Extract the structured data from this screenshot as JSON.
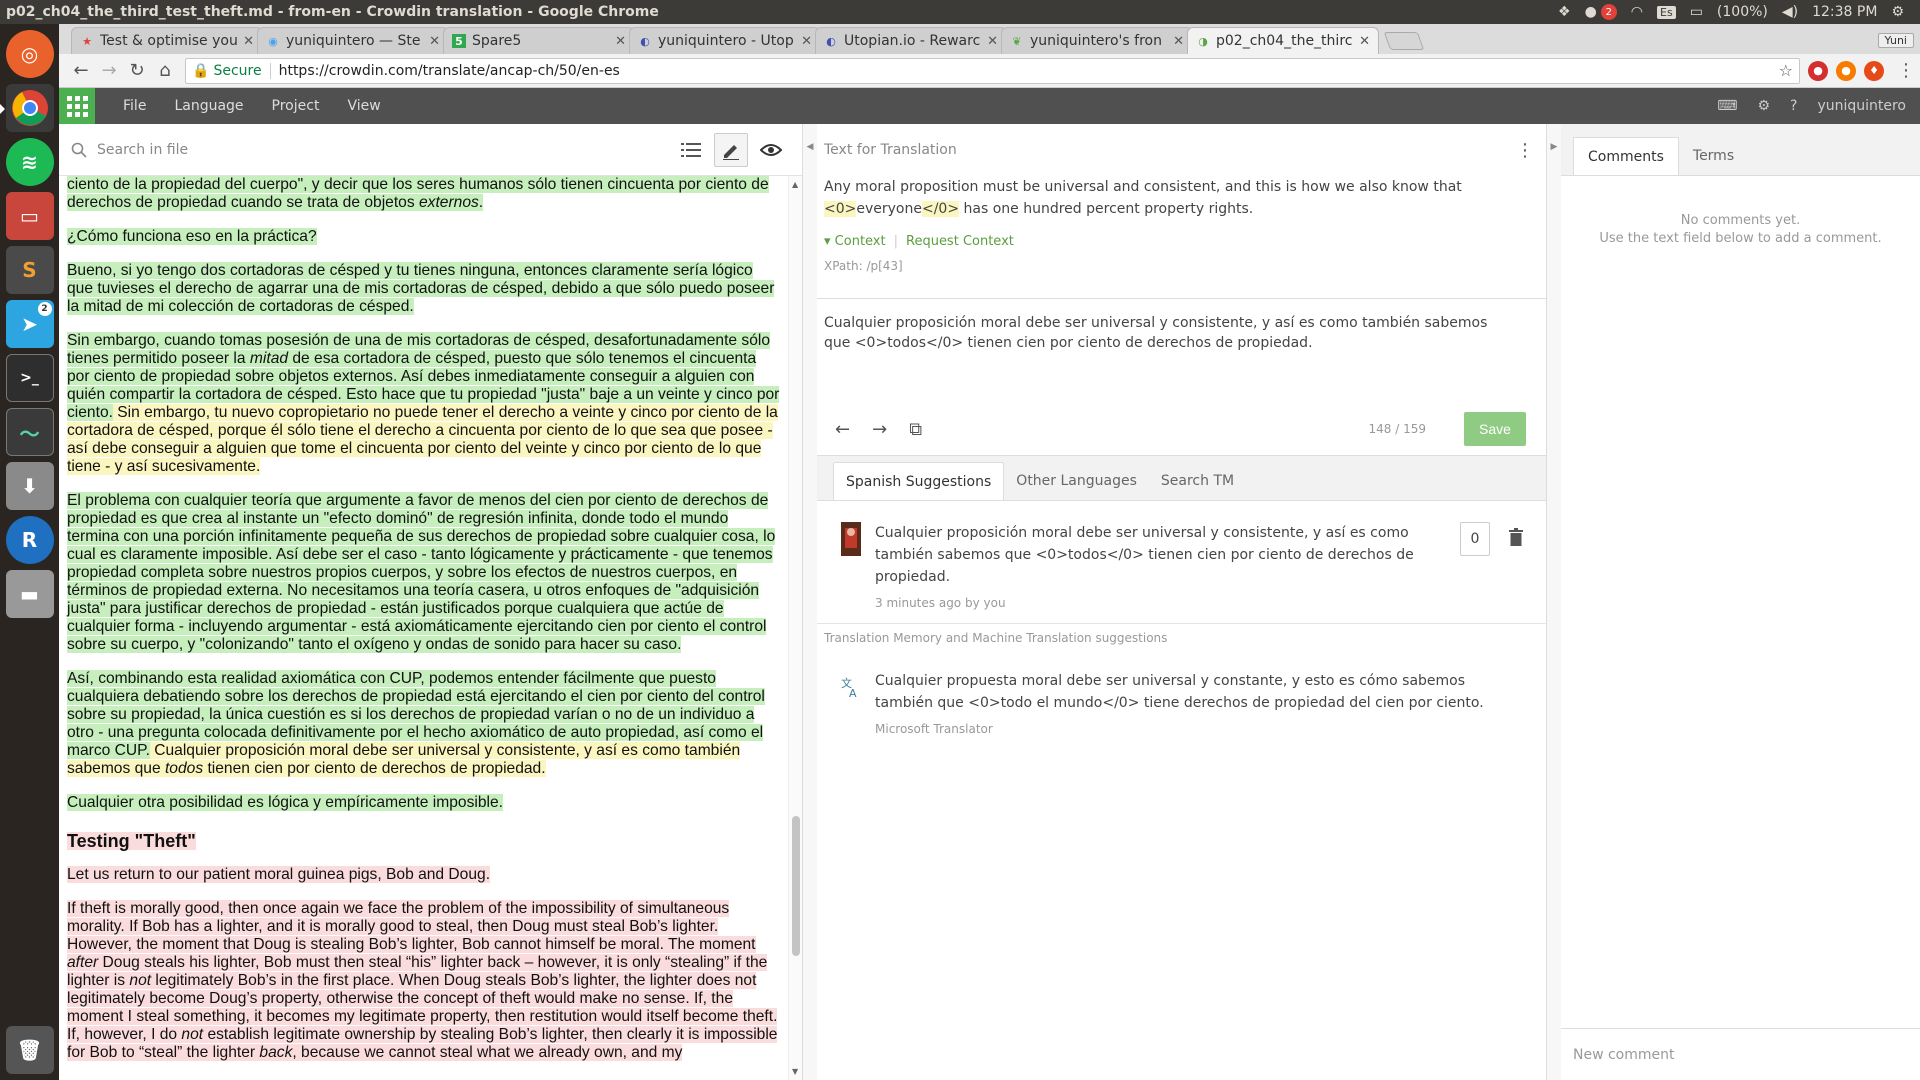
{
  "os": {
    "window_title": "p02_ch04_the_third_test_theft.md - from-en - Crowdin translation - Google Chrome",
    "tray": {
      "notification_count": "2",
      "keyboard": "Es",
      "battery": "(100%)",
      "time": "12:38 PM"
    },
    "launcher_badges": {
      "telegram": "2"
    }
  },
  "browser": {
    "tabs": [
      {
        "label": "Test & optimise you",
        "icon": "star-icon",
        "color": "#e0413b",
        "active": false
      },
      {
        "label": "yuniquintero — Ste",
        "icon": "steem-icon",
        "color": "#4ba2f2",
        "active": false
      },
      {
        "label": "Spare5",
        "icon": "spare5-icon",
        "color": "#2fa84f",
        "active": false
      },
      {
        "label": "yuniquintero - Utop",
        "icon": "utopian-icon",
        "color": "#3f51b5",
        "active": false
      },
      {
        "label": "Utopian.io - Rewarc",
        "icon": "utopian-icon",
        "color": "#3f51b5",
        "active": false
      },
      {
        "label": "yuniquintero's fron",
        "icon": "leaf-icon",
        "color": "#5aa845",
        "active": false
      },
      {
        "label": "p02_ch04_the_thirc",
        "icon": "crowdin-icon",
        "color": "#5aa845",
        "active": true
      }
    ],
    "profile": "Yuni",
    "secure_label": "Secure",
    "url": "https://crowdin.com/translate/ancap-ch/50/en-es"
  },
  "app": {
    "menu": [
      "File",
      "Language",
      "Project",
      "View"
    ],
    "user": "yuniquintero"
  },
  "left_panel": {
    "search_placeholder": "Search in file",
    "paragraphs": {
      "p1a": "ciento de la propiedad del cuerpo\", y decir que los seres humanos sólo tienen cincuenta por ciento de derechos de propiedad cuando se trata de objetos ",
      "p1b": "externos",
      "p1c": ".",
      "p2": "¿Cómo funciona eso en la práctica?",
      "p3": "Bueno, si yo tengo dos cortadoras de césped y tu tienes ninguna, entonces claramente sería lógico que tuvieses el derecho de agarrar una de mis cortadoras de césped, debido a que sólo puedo poseer la mitad de mi colección de cortadoras de césped.",
      "p4a": "Sin embargo, cuando tomas posesión de una de mis cortadoras de césped, desafortunadamente sólo tienes permitido poseer la ",
      "p4b": "mitad",
      "p4c": " de esa cortadora de césped, puesto que sólo tenemos el cincuenta por ciento de propiedad sobre objetos externos. Así debes inmediatamente conseguir a alguien con quién compartir la cortadora de césped. Esto hace que tu propiedad \"justa\" baje a un veinte y cinco por ciento.",
      "p4d": " Sin embargo, tu nuevo copropietario no puede tener el derecho a veinte y cinco por ciento de la cortadora de césped, porque él sólo tiene el derecho a cincuenta por ciento de lo que sea que posee - así debe conseguir a alguien que tome el cincuenta por ciento del veinte y cinco por ciento de lo que tiene - y así sucesivamente.",
      "p5": "El problema con cualquier teoría que argumente a favor de menos del cien por ciento de derechos de propiedad es que crea al instante un \"efecto dominó\" de regresión infinita, donde todo el mundo termina con una porción infinitamente pequeña de sus derechos de propiedad sobre cualquier cosa, lo cual es claramente imposible. Así debe ser el caso - tanto lógicamente y prácticamente - que tenemos propiedad completa sobre nuestros propios cuerpos, y sobre los efectos de nuestros cuerpos, en términos de propiedad externa. No necesitamos una teoría casera, u otros enfoques de \"adquisición justa\" para justificar derechos de propiedad - están justificados porque cualquiera que actúe de cualquier forma - incluyendo argumentar - está axiomáticamente ejercitando cien por ciento el control sobre su cuerpo, y \"colonizando\" tanto el oxígeno y ondas de sonido para hacer su caso.",
      "p6a": "Así, combinando esta realidad axiomática con CUP, podemos entender fácilmente que puesto cualquiera debatiendo sobre los derechos de propiedad está ejercitando el cien por ciento del control sobre su propiedad, la única cuestión es si los derechos de propiedad varían o no de un individuo a otro - una pregunta colocada definitivamente por el hecho axiomático de auto propiedad, así como el marco CUP.",
      "p6b": " Cualquier proposición moral debe ser universal y consistente, y así es como también sabemos que ",
      "p6c": "todos",
      "p6d": " tienen cien por ciento de derechos de propiedad.",
      "p7": "Cualquier otra posibilidad es lógica y empíricamente imposible.",
      "h_testing": "Testing \"Theft\"",
      "p8": "Let us return to our patient moral guinea pigs, Bob and Doug.",
      "p9a": "If theft is morally good, then once again we face the problem of the impossibility of simultaneous morality. If Bob has a lighter, and it is morally good to steal, then Doug must steal Bob’s lighter. However, the moment that Doug is stealing Bob’s lighter, Bob cannot himself be moral. The moment ",
      "p9b": "after",
      "p9c": " Doug steals his lighter, Bob must then steal “his” lighter back – however, it is only “stealing” if the lighter is ",
      "p9d": "not",
      "p9e": " legitimately Bob’s in the first place. When Doug steals Bob’s lighter, the lighter does not legitimately become Doug’s property, otherwise the concept of theft would make no sense. If, the moment I steal something, it becomes my legitimate property, then restitution would itself become theft. If, however, I do ",
      "p9f": "not",
      "p9g": " establish legitimate ownership by stealing Bob’s lighter, then clearly it is impossible for Bob to “steal” the lighter ",
      "p9h": "back",
      "p9i": ", because we cannot steal what we already own, and my"
    }
  },
  "editor": {
    "header": "Text for Translation",
    "source_pre": "Any moral proposition must be universal and consistent, and this is how we also know that ",
    "source_tag_open": "<0>",
    "source_word": "everyone",
    "source_tag_close": "</0>",
    "source_post": " has one hundred percent property rights.",
    "context_label": "Context",
    "request_context": "Request Context",
    "xpath": "XPath: /p[43]",
    "translation": "Cualquier proposición moral debe ser universal y consistente, y así es como también sabemos que <0>todos</0> tienen cien por ciento de derechos de propiedad.",
    "char_count": "148 / 159",
    "save_label": "Save",
    "tabs": [
      "Spanish Suggestions",
      "Other Languages",
      "Search TM"
    ],
    "suggestion": {
      "text": "Cualquier proposición moral debe ser universal y consistente, y así es como también sabemos que <0>todos</0> tienen cien por ciento de derechos de propiedad.",
      "meta": "3 minutes ago by you",
      "votes": "0"
    },
    "tm_label": "Translation Memory and Machine Translation suggestions",
    "mt": {
      "text": "Cualquier propuesta moral debe ser universal y constante, y esto es cómo sabemos también que <0>todo el mundo</0> tiene derechos de propiedad del cien por ciento.",
      "source": "Microsoft Translator"
    }
  },
  "comments": {
    "tabs": [
      "Comments",
      "Terms"
    ],
    "empty_line1": "No comments yet.",
    "empty_line2": "Use the text field below to add a comment.",
    "placeholder": "New comment"
  }
}
